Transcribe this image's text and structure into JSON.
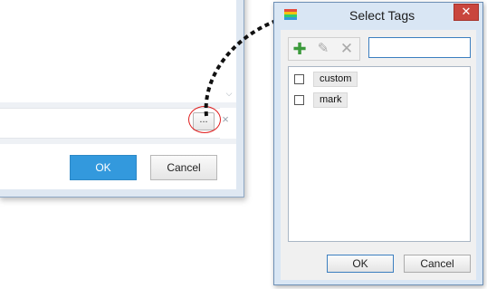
{
  "background_dialog": {
    "scroll_icon": "chevron-down-icon",
    "ellipsis_label": "...",
    "clear_icon": "close-icon",
    "clear_glyph": "×",
    "ok_label": "OK",
    "cancel_label": "Cancel",
    "accent_color": "#3399dd",
    "highlight_color": "#e02020"
  },
  "tags_window": {
    "title": "Select Tags",
    "close_glyph": "✕",
    "toolbar": {
      "add_icon": "plus-icon",
      "add_glyph": "✚",
      "edit_icon": "pencil-icon",
      "edit_glyph": "✎",
      "delete_icon": "delete-icon",
      "delete_glyph": "✕"
    },
    "search": {
      "value": "",
      "placeholder": ""
    },
    "tags": [
      {
        "label": "custom",
        "checked": false
      },
      {
        "label": "mark",
        "checked": false
      }
    ],
    "ok_label": "OK",
    "cancel_label": "Cancel"
  }
}
